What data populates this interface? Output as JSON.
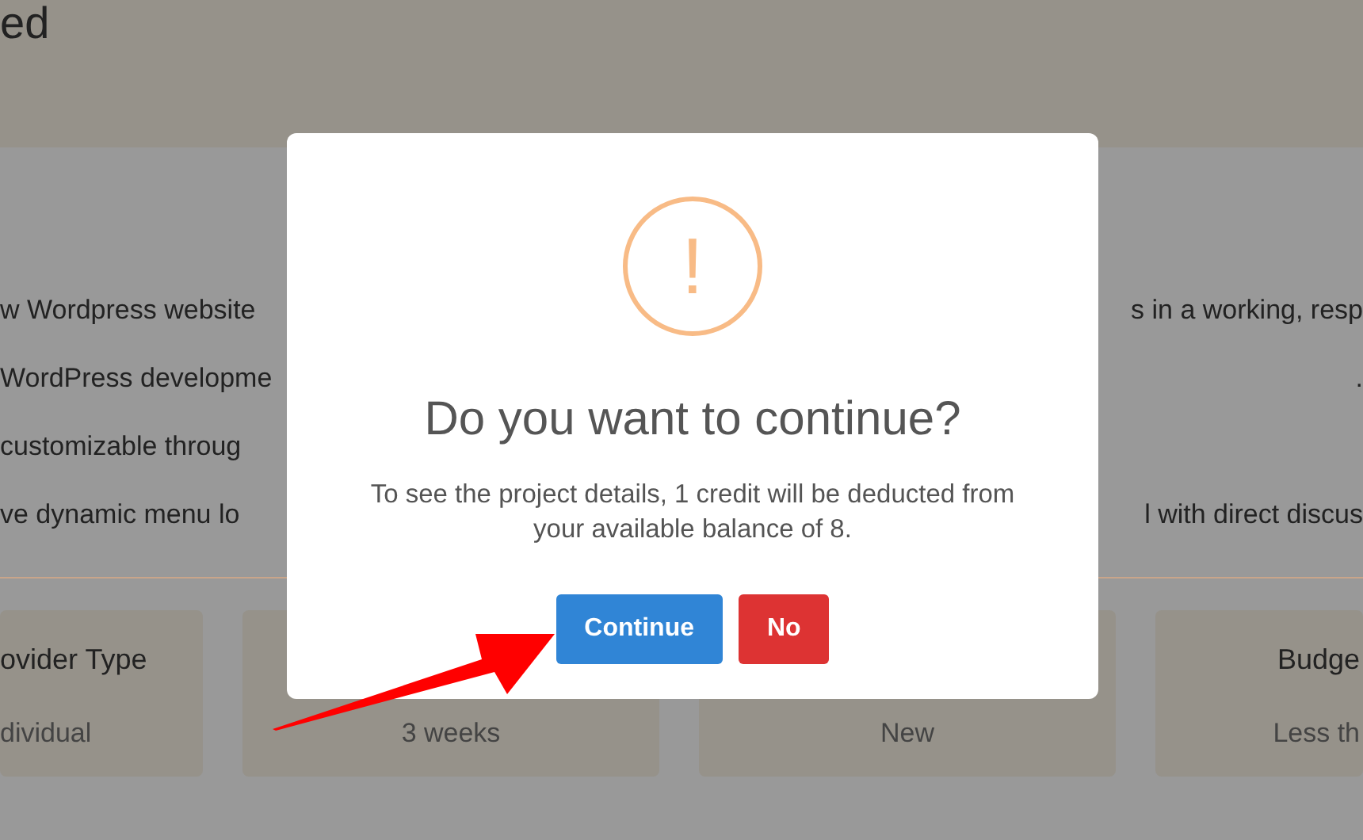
{
  "header": {
    "title": "ed"
  },
  "description_lines": [
    {
      "left": "w Wordpress website",
      "right": "s in a working, resp"
    },
    {
      "left": "WordPress developme",
      "right": "."
    },
    {
      "left": "customizable throug"
    },
    {
      "left": "ve dynamic menu lo",
      "right": "l with direct discus"
    }
  ],
  "cards": [
    {
      "title": "ovider Type",
      "value": "dividual"
    },
    {
      "value": "3 weeks"
    },
    {
      "value": "New"
    },
    {
      "title": "Budge",
      "value": "Less th"
    }
  ],
  "dialog": {
    "title": "Do you want to continue?",
    "message": "To see the project details, 1 credit will be deducted from your available balance of 8.",
    "icon_text": "!",
    "buttons": [
      {
        "label": "Continue",
        "kind": "confirm"
      },
      {
        "label": "No",
        "kind": "cancel"
      }
    ]
  }
}
